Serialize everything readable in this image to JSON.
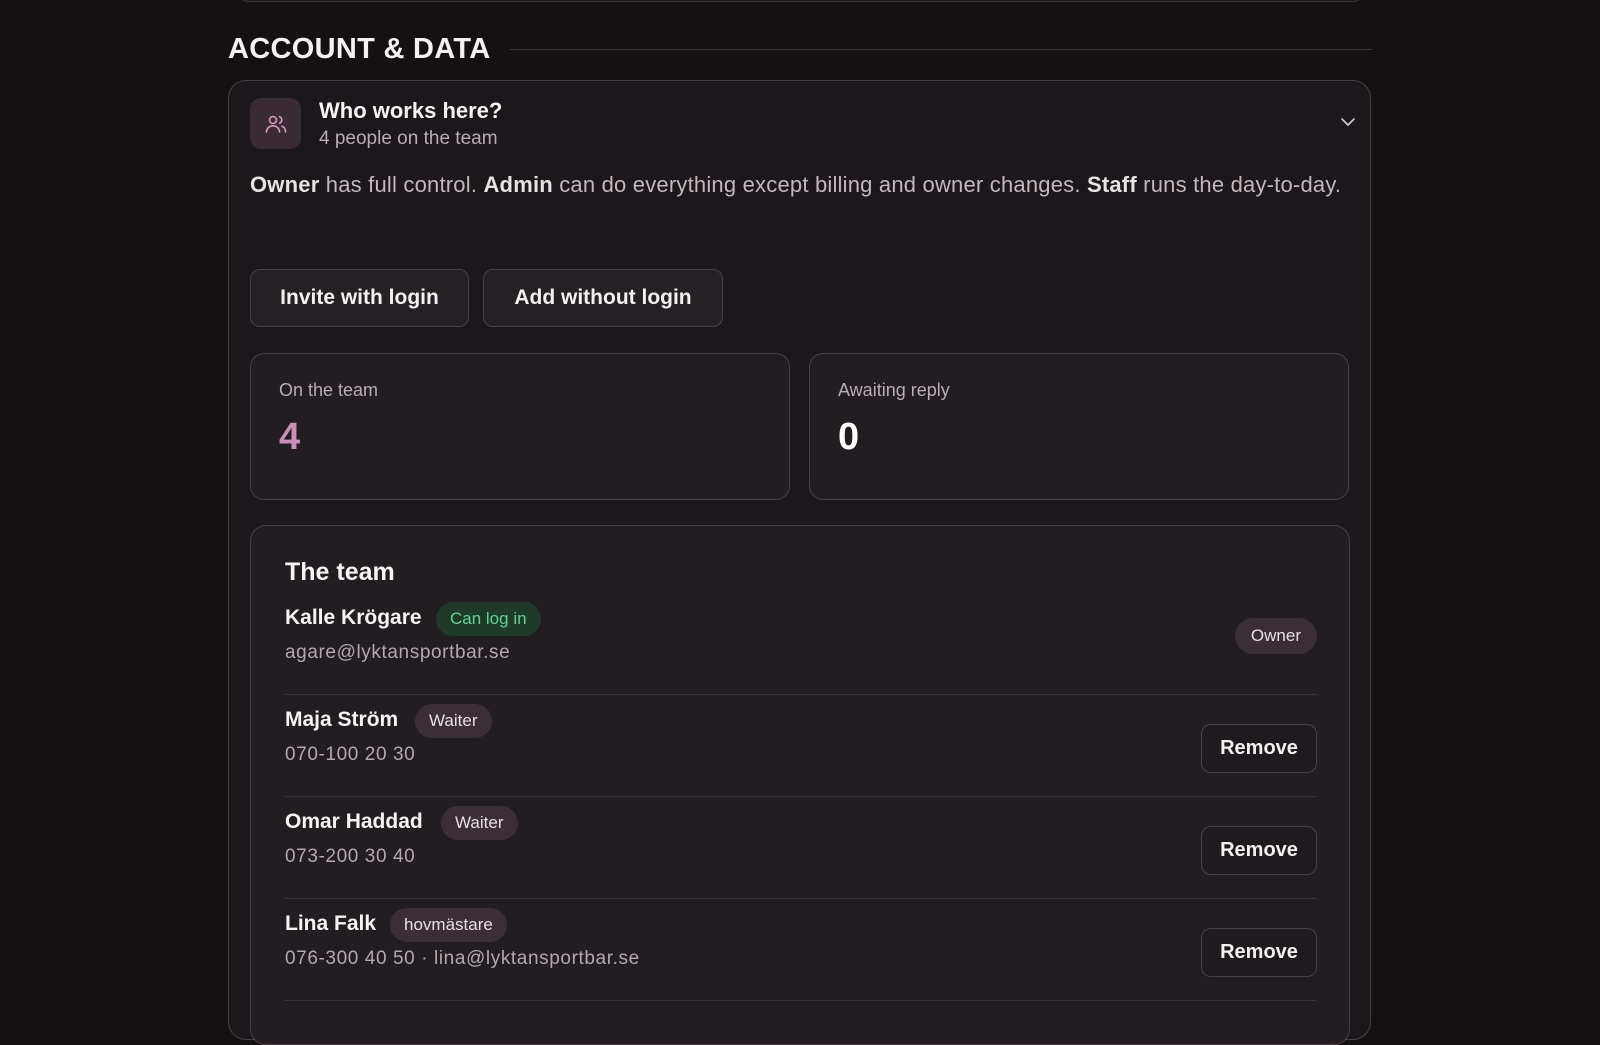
{
  "section": {
    "title": "ACCOUNT & DATA"
  },
  "card": {
    "title": "Who works here?",
    "subtitle": "4 people on the team",
    "icon": "users-icon",
    "description": {
      "role1": "Owner",
      "text1": " has full control. ",
      "role2": "Admin",
      "text2": " can do everything except billing and owner changes. ",
      "role3": "Staff",
      "text3": " runs the day-to-day."
    }
  },
  "actions": {
    "invite_label": "Invite with login",
    "add_label": "Add without login"
  },
  "stats": {
    "on_team_label": "On the team",
    "on_team_value": "4",
    "awaiting_label": "Awaiting reply",
    "awaiting_value": "0"
  },
  "team": {
    "title": "The team",
    "members": [
      {
        "name": "Kalle Krögare",
        "badge": "Can log in",
        "contact": "agare@lyktansportbar.se",
        "role_tag": "Owner"
      },
      {
        "name": "Maja Ström",
        "badge": "Waiter",
        "contact": "070-100 20 30",
        "action": "Remove"
      },
      {
        "name": "Omar Haddad",
        "badge": "Waiter",
        "contact": "073-200 30 40",
        "action": "Remove"
      },
      {
        "name": "Lina Falk",
        "badge": "hovmästare",
        "contact": "076-300 40 50 · lina@lyktansportbar.se",
        "action": "Remove"
      }
    ]
  },
  "colors": {
    "background": "#141113",
    "accent_pink": "#c98fb4",
    "green_badge": "#5fd391"
  }
}
